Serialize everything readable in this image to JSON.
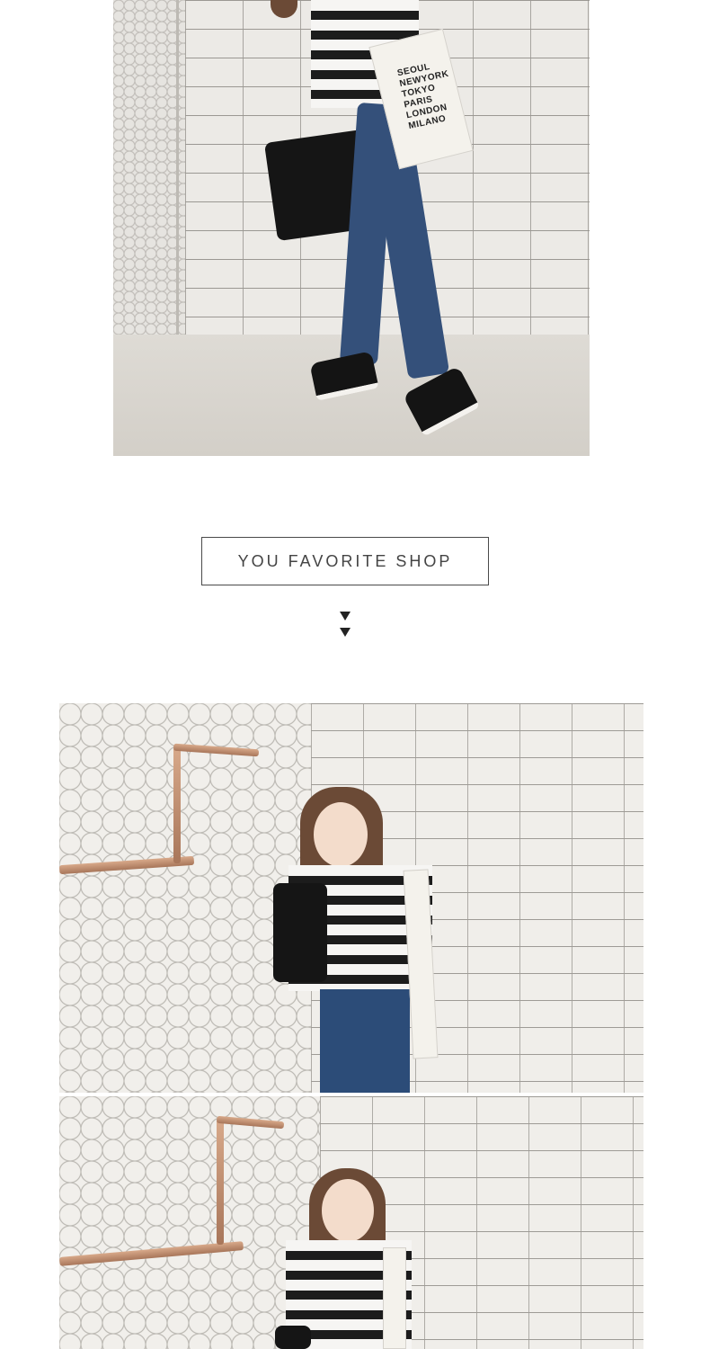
{
  "top_photo": {
    "alt": "model in striped tee and skinny jeans",
    "tote_print": [
      "SEOUL",
      "NEWYORK",
      "TOKYO",
      "PARIS",
      "LONDON",
      "MILANO"
    ]
  },
  "section": {
    "label": "YOU FAVORITE SHOP"
  },
  "middle_photo": {
    "alt": "model posing in striped tee against tiled wall"
  },
  "bottom_photo": {
    "alt": "model smiling in striped tee"
  },
  "colors": {
    "label_border": "#4a4a4a",
    "label_text": "#444444",
    "arrow": "#222222"
  }
}
